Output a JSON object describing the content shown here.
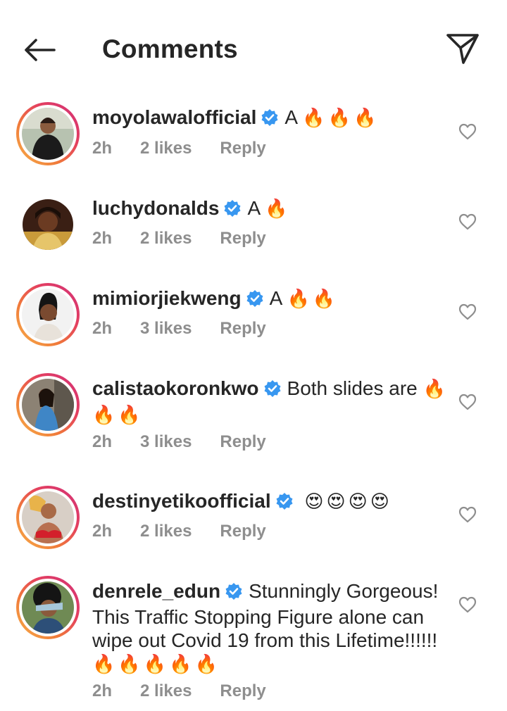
{
  "header": {
    "title": "Comments",
    "back_icon": "arrow-left-icon",
    "send_icon": "paper-plane-icon"
  },
  "colors": {
    "verified_badge": "#3897f0",
    "meta_text": "#8e8e8e",
    "story_ring_start": "#f7b24a",
    "story_ring_end": "#d1307a"
  },
  "comments": [
    {
      "username": "moyolawalofficial",
      "verified": true,
      "text": "A",
      "emojis": "🔥🔥🔥",
      "time": "2h",
      "likes": "2 likes",
      "reply": "Reply"
    },
    {
      "username": "luchydonalds",
      "verified": true,
      "text": "A",
      "emojis": "🔥",
      "time": "2h",
      "likes": "2 likes",
      "reply": "Reply"
    },
    {
      "username": "mimiorjiekweng",
      "verified": true,
      "text": "A",
      "emojis": "🔥🔥",
      "time": "2h",
      "likes": "3 likes",
      "reply": "Reply"
    },
    {
      "username": "calistaokoronkwo",
      "verified": true,
      "text": "Both slides are",
      "emojis": "🔥🔥🔥",
      "time": "2h",
      "likes": "3 likes",
      "reply": "Reply"
    },
    {
      "username": "destinyetikoofficial",
      "verified": true,
      "text": "",
      "emojis": "😍😍😍😍",
      "time": "2h",
      "likes": "2 likes",
      "reply": "Reply"
    },
    {
      "username": "denrele_edun",
      "verified": true,
      "text": "Stunningly Gorgeous! This Traffic Stopping Figure alone can wipe out Covid 19 from this Lifetime!!!!!!",
      "emojis": "🔥🔥🔥🔥🔥",
      "time": "2h",
      "likes": "2 likes",
      "reply": "Reply"
    }
  ]
}
